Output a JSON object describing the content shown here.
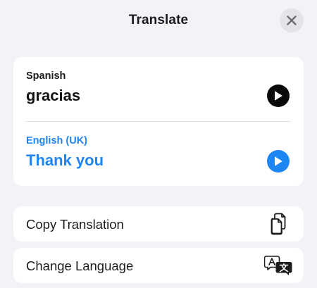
{
  "header": {
    "title": "Translate"
  },
  "translation": {
    "source_language": "Spanish",
    "source_text": "gracias",
    "target_language": "English (UK)",
    "target_text": "Thank you"
  },
  "actions": {
    "copy_label": "Copy Translation",
    "change_language_label": "Change Language"
  },
  "icons": {
    "close": "close-icon",
    "play_source": "play-icon",
    "play_target": "play-icon",
    "copy": "copy-documents-icon",
    "change_language": "translate-icon"
  },
  "colors": {
    "accent": "#1e86f3",
    "background": "#f2f2f7",
    "card": "#ffffff"
  }
}
